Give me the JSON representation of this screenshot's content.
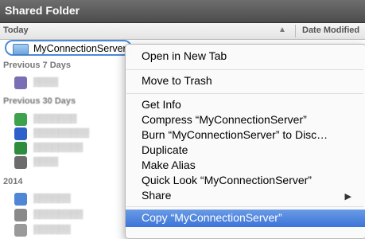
{
  "window": {
    "title": "Shared Folder"
  },
  "columns": {
    "name_header": "Today",
    "date_header": "Date Modified"
  },
  "selected": {
    "name": "MyConnectionServer"
  },
  "sections": {
    "previous_7_days": "Previous 7 Days",
    "previous_30_days": "Previous 30 Days",
    "year": "2014"
  },
  "menu": {
    "items": [
      {
        "label": "Open in New Tab"
      },
      {
        "label": "Move to Trash"
      },
      {
        "label": "Get Info"
      },
      {
        "label": "Compress “MyConnectionServer”"
      },
      {
        "label": "Burn “MyConnectionServer” to Disc…"
      },
      {
        "label": "Duplicate"
      },
      {
        "label": "Make Alias"
      },
      {
        "label": "Quick Look “MyConnectionServer”"
      },
      {
        "label": "Share"
      },
      {
        "label": "Copy “MyConnectionServer”"
      }
    ]
  },
  "colors": {
    "highlight": "#3c74d8",
    "selection_border": "#4a8bd8"
  }
}
